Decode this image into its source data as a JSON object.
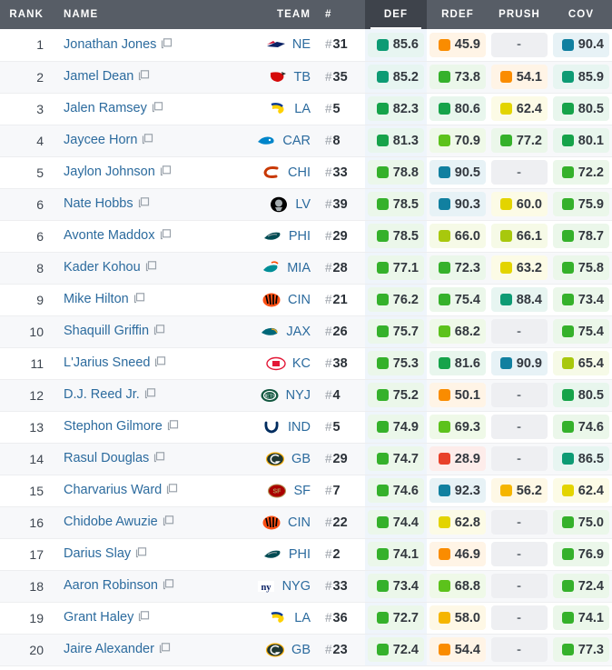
{
  "table": {
    "columns": [
      {
        "key": "rank",
        "label": "RANK",
        "active": false
      },
      {
        "key": "name",
        "label": "NAME",
        "active": false
      },
      {
        "key": "team",
        "label": "TEAM",
        "active": false
      },
      {
        "key": "num",
        "label": "#",
        "active": false
      },
      {
        "key": "def",
        "label": "DEF",
        "active": true
      },
      {
        "key": "rdef",
        "label": "RDEF",
        "active": false
      },
      {
        "key": "prush",
        "label": "PRUSH",
        "active": false
      },
      {
        "key": "cov",
        "label": "COV",
        "active": false
      }
    ],
    "sorted_by": "DEF",
    "sort_direction": "descending",
    "empty_value": "-",
    "row_icon": "compare-icon",
    "rows": [
      {
        "rank": "1",
        "name": "Jonathan Jones",
        "team": "NE",
        "number": "# 31",
        "def": "85.6",
        "rdef": "45.9",
        "prush": "-",
        "cov": "90.4"
      },
      {
        "rank": "2",
        "name": "Jamel Dean",
        "team": "TB",
        "number": "# 35",
        "def": "85.2",
        "rdef": "73.8",
        "prush": "54.1",
        "cov": "85.9"
      },
      {
        "rank": "3",
        "name": "Jalen Ramsey",
        "team": "LA",
        "number": "# 5",
        "def": "82.3",
        "rdef": "80.6",
        "prush": "62.4",
        "cov": "80.5"
      },
      {
        "rank": "4",
        "name": "Jaycee Horn",
        "team": "CAR",
        "number": "# 8",
        "def": "81.3",
        "rdef": "70.9",
        "prush": "77.2",
        "cov": "80.1"
      },
      {
        "rank": "5",
        "name": "Jaylon Johnson",
        "team": "CHI",
        "number": "# 33",
        "def": "78.8",
        "rdef": "90.5",
        "prush": "-",
        "cov": "72.2"
      },
      {
        "rank": "6",
        "name": "Nate Hobbs",
        "team": "LV",
        "number": "# 39",
        "def": "78.5",
        "rdef": "90.3",
        "prush": "60.0",
        "cov": "75.9"
      },
      {
        "rank": "6",
        "name": "Avonte Maddox",
        "team": "PHI",
        "number": "# 29",
        "def": "78.5",
        "rdef": "66.0",
        "prush": "66.1",
        "cov": "78.7"
      },
      {
        "rank": "8",
        "name": "Kader Kohou",
        "team": "MIA",
        "number": "# 28",
        "def": "77.1",
        "rdef": "72.3",
        "prush": "63.2",
        "cov": "75.8"
      },
      {
        "rank": "9",
        "name": "Mike Hilton",
        "team": "CIN",
        "number": "# 21",
        "def": "76.2",
        "rdef": "75.4",
        "prush": "88.4",
        "cov": "73.4"
      },
      {
        "rank": "10",
        "name": "Shaquill Griffin",
        "team": "JAX",
        "number": "# 26",
        "def": "75.7",
        "rdef": "68.2",
        "prush": "-",
        "cov": "75.4"
      },
      {
        "rank": "11",
        "name": "L'Jarius Sneed",
        "team": "KC",
        "number": "# 38",
        "def": "75.3",
        "rdef": "81.6",
        "prush": "90.9",
        "cov": "65.4"
      },
      {
        "rank": "12",
        "name": "D.J. Reed Jr.",
        "team": "NYJ",
        "number": "# 4",
        "def": "75.2",
        "rdef": "50.1",
        "prush": "-",
        "cov": "80.5"
      },
      {
        "rank": "13",
        "name": "Stephon Gilmore",
        "team": "IND",
        "number": "# 5",
        "def": "74.9",
        "rdef": "69.3",
        "prush": "-",
        "cov": "74.6"
      },
      {
        "rank": "14",
        "name": "Rasul Douglas",
        "team": "GB",
        "number": "# 29",
        "def": "74.7",
        "rdef": "28.9",
        "prush": "-",
        "cov": "86.5"
      },
      {
        "rank": "15",
        "name": "Charvarius Ward",
        "team": "SF",
        "number": "# 7",
        "def": "74.6",
        "rdef": "92.3",
        "prush": "56.2",
        "cov": "62.4"
      },
      {
        "rank": "16",
        "name": "Chidobe Awuzie",
        "team": "CIN",
        "number": "# 22",
        "def": "74.4",
        "rdef": "62.8",
        "prush": "-",
        "cov": "75.0"
      },
      {
        "rank": "17",
        "name": "Darius Slay",
        "team": "PHI",
        "number": "# 2",
        "def": "74.1",
        "rdef": "46.9",
        "prush": "-",
        "cov": "76.9"
      },
      {
        "rank": "18",
        "name": "Aaron Robinson",
        "team": "NYG",
        "number": "# 33",
        "def": "73.4",
        "rdef": "68.8",
        "prush": "-",
        "cov": "72.4"
      },
      {
        "rank": "19",
        "name": "Grant Haley",
        "team": "LA",
        "number": "# 36",
        "def": "72.7",
        "rdef": "58.0",
        "prush": "-",
        "cov": "74.1"
      },
      {
        "rank": "20",
        "name": "Jaire Alexander",
        "team": "GB",
        "number": "# 23",
        "def": "72.4",
        "rdef": "54.4",
        "prush": "-",
        "cov": "77.3"
      }
    ]
  },
  "grade_colors": {
    "elite": "#1180a0",
    "very_high": "#0d9b74",
    "high": "#16a34a",
    "good": "#35b12b",
    "above_avg": "#5cc21b",
    "average": "#a8c80d",
    "below_avg": "#e3d400",
    "low": "#f5b500",
    "poor": "#fa8c00",
    "very_poor": "#e8402a"
  },
  "team_colors": {
    "NE": {
      "primary": "#0b2265",
      "secondary": "#c60c30"
    },
    "TB": {
      "primary": "#d50a0a",
      "secondary": "#34302b"
    },
    "LA": {
      "primary": "#003594",
      "secondary": "#ffd100"
    },
    "CAR": {
      "primary": "#0085ca",
      "secondary": "#101820"
    },
    "CHI": {
      "primary": "#c83803",
      "secondary": "#0b162a"
    },
    "LV": {
      "primary": "#000000",
      "secondary": "#a5acaf"
    },
    "PHI": {
      "primary": "#004c54",
      "secondary": "#a5acaf"
    },
    "MIA": {
      "primary": "#008e97",
      "secondary": "#fc4c02"
    },
    "CIN": {
      "primary": "#fb4f14",
      "secondary": "#000000"
    },
    "JAX": {
      "primary": "#006778",
      "secondary": "#d7a22a"
    },
    "KC": {
      "primary": "#e31837",
      "secondary": "#ffb81c"
    },
    "NYJ": {
      "primary": "#125740",
      "secondary": "#ffffff"
    },
    "IND": {
      "primary": "#002c5f",
      "secondary": "#ffffff"
    },
    "GB": {
      "primary": "#203731",
      "secondary": "#ffb612"
    },
    "SF": {
      "primary": "#aa0000",
      "secondary": "#b3995d"
    },
    "NYG": {
      "primary": "#0b2265",
      "secondary": "#a71930"
    }
  }
}
